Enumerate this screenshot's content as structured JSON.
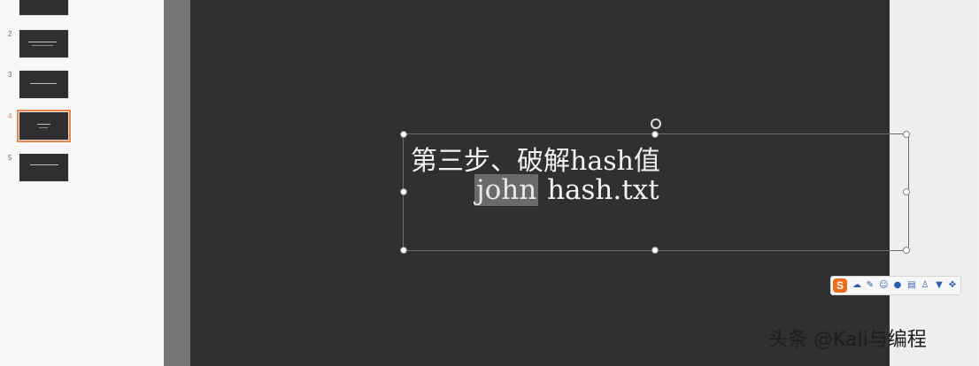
{
  "thumbnails": [
    {
      "number": ""
    },
    {
      "number": "2"
    },
    {
      "number": "3"
    },
    {
      "number": "4"
    },
    {
      "number": "5"
    }
  ],
  "slide": {
    "line1": "第三步、破解hash值",
    "line2_selected": "john",
    "line2_rest": " hash.txt"
  },
  "ime_toolbar": {
    "logo": "S",
    "icons": [
      "cloud-icon",
      "brush-icon",
      "emoji-icon",
      "mic-icon",
      "keyboard-icon",
      "user-icon",
      "shirt-icon",
      "tools-icon"
    ]
  },
  "watermark": {
    "text": "头条 @Kali与编程"
  },
  "colors": {
    "slide_bg": "#303032",
    "selection_accent": "#e8844f",
    "ime_orange": "#f06a18"
  }
}
